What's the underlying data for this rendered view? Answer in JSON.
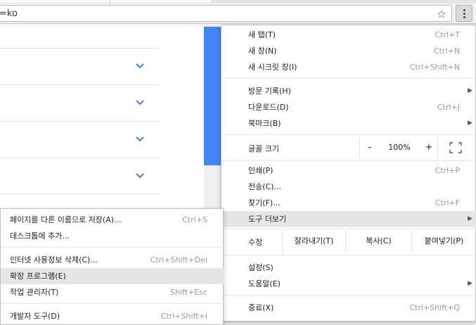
{
  "address_bar": {
    "text": "=ko"
  },
  "page_menu": {
    "items": [
      {
        "label": "새 탭(T)",
        "shortcut": "Ctrl+T"
      },
      {
        "label": "새 창(N)",
        "shortcut": "Ctrl+N"
      },
      {
        "label": "새 시크릿 창(I)",
        "shortcut": "Ctrl+Shift+N"
      },
      {
        "label": "방문 기록(H)"
      },
      {
        "label": "다운로드(D)",
        "shortcut": "Ctrl+J"
      },
      {
        "label": "북마크(B)"
      },
      {
        "label": "인쇄(P)",
        "shortcut": "Ctrl+P"
      },
      {
        "label": "전송(C)..."
      },
      {
        "label": "찾기(F)...",
        "shortcut": "Ctrl+F"
      },
      {
        "label": "도구 더보기"
      },
      {
        "label": "설정(S)"
      },
      {
        "label": "도움말(E)"
      },
      {
        "label": "종료(X)",
        "shortcut": "Ctrl+Shift+Q"
      }
    ],
    "zoom": {
      "label": "글꼴 크기",
      "minus": "-",
      "level": "100%",
      "plus": "+"
    },
    "edit": {
      "label": "수정",
      "cut": "잘라내기(T)",
      "copy": "복사(C)",
      "paste": "붙여넣기(P)"
    }
  },
  "more_tools_menu": {
    "items": [
      {
        "label": "페이지를 다른 이름으로 저장(A)...",
        "shortcut": "Ctrl+S"
      },
      {
        "label": "데스크톱에 추가..."
      },
      {
        "label": "인터넷 사용정보 삭제(C)...",
        "shortcut": "Ctrl+Shift+Del"
      },
      {
        "label": "확장 프로그램(E)"
      },
      {
        "label": "작업 관리자(T)",
        "shortcut": "Shift+Esc"
      },
      {
        "label": "개발자 도구(D)",
        "shortcut": "Ctrl+Shift+I"
      }
    ]
  },
  "colors": {
    "scroll_thumb": "#4285f4",
    "chevron": "#4a7fd4",
    "highlight": "#e6e6e6"
  },
  "icons": {
    "bookmark": "star-icon",
    "menu": "kebab-menu-icon",
    "fullscreen": "fullscreen-icon",
    "expand": "chevron-down-icon"
  }
}
